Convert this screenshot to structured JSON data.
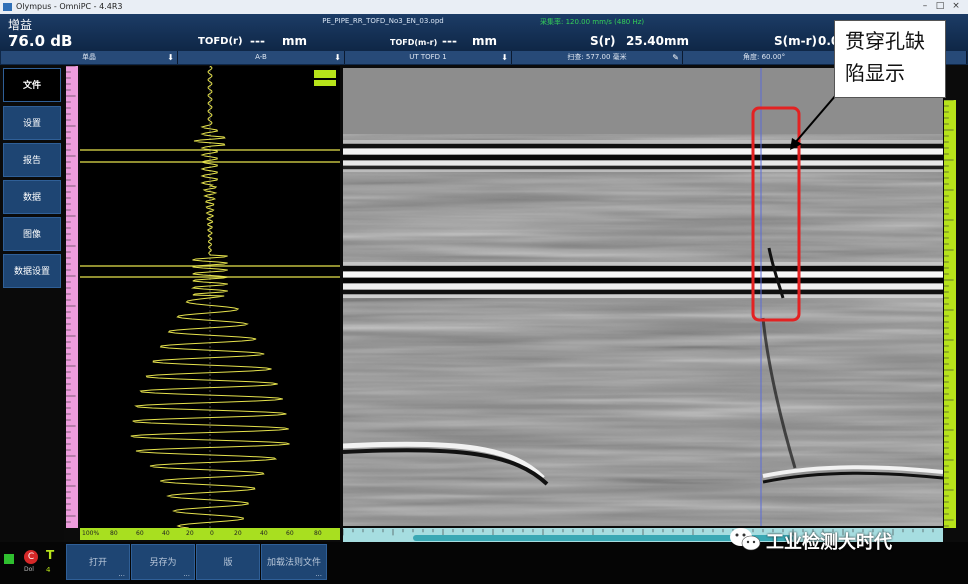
{
  "window": {
    "title": "Olympus - OmniPC - 4.4R3"
  },
  "header": {
    "gain_label": "增益",
    "gain_value": "76.0 dB",
    "file_name": "PE_PIPE_RR_TOFD_No3_EN_03.opd",
    "speed": "采集率: 120.00 mm/s (480 Hz)",
    "tofd_r_label": "TOFD(r)",
    "tofd_r_value": "---",
    "tofd_r_unit": "mm",
    "tofd_mr_label": "TOFD(m-r)",
    "tofd_mr_value": "---",
    "tofd_mr_unit": "mm",
    "s_r_label": "S(r)",
    "s_r_value": "25.40",
    "s_r_unit": "mm",
    "s_mr_label": "S(m-r)",
    "s_mr_value": "0.0"
  },
  "columns": {
    "col1": "单晶",
    "col2": "A-B",
    "col3": "UT TOFD 1",
    "col4": "扫查: 577.00 毫米",
    "col5": "角度: 60.00°"
  },
  "sidebar": {
    "items": [
      {
        "label": "文件"
      },
      {
        "label": "设置"
      },
      {
        "label": "报告"
      },
      {
        "label": "数据"
      },
      {
        "label": "图像"
      },
      {
        "label": "数据设置"
      }
    ]
  },
  "ascan": {
    "ticks": [
      "100%",
      "80",
      "60",
      "40",
      "20",
      "0",
      "20",
      "40",
      "60",
      "80"
    ]
  },
  "bottom": {
    "buttons": [
      {
        "label": "打开"
      },
      {
        "label": "另存为"
      },
      {
        "label": "版"
      },
      {
        "label": "加载法则文件"
      }
    ],
    "status_c": "C",
    "status_t": "T",
    "status_t_sub": "4",
    "status_left_sub": "Dol"
  },
  "callout": {
    "line1": "贯穿孔缺",
    "line2": "陷显示"
  },
  "watermark": {
    "text": "工业检测大时代"
  },
  "colors": {
    "highlight": "#e32222",
    "accent_green": "#b7e31a",
    "ruler_pink": "#ee9ddd"
  }
}
